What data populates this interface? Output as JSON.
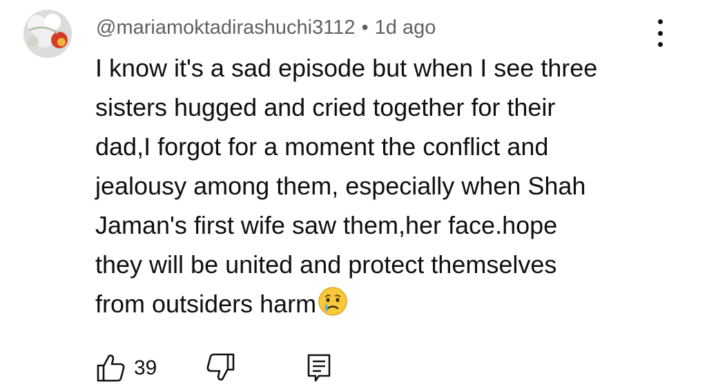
{
  "comment": {
    "author": "@mariamoktadirashuchi3112",
    "separator": "•",
    "time": "1d ago",
    "text_lines": [
      "I know it's a sad episode but when I see three",
      "sisters hugged and cried together for their",
      "dad,I forgot for a moment the conflict and",
      "jealousy among them, especially when Shah",
      "Jaman's first wife saw them,her face.hope",
      "they will be united and protect themselves",
      "from outsiders harm"
    ],
    "trailing_emoji": "crying-face-emoji"
  },
  "actions": {
    "like_icon": "thumbs-up-icon",
    "like_count": "39",
    "dislike_icon": "thumbs-down-icon",
    "reply_icon": "reply-comment-icon",
    "menu_icon": "more-vertical-icon"
  },
  "colors": {
    "meta_text": "#606060",
    "body_text": "#0f0f0f",
    "background": "#ffffff"
  }
}
